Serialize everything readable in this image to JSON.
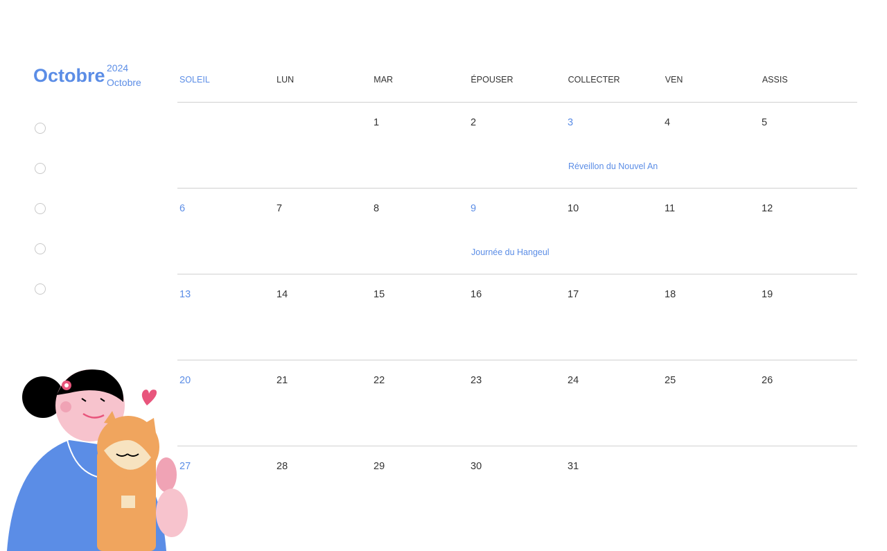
{
  "header": {
    "month": "Octobre",
    "year": "2024",
    "month_sub": "Octobre"
  },
  "checklist_count": 5,
  "weekdays": [
    "SOLEIL",
    "LUN",
    "MAR",
    "ÉPOUSER",
    "COLLECTER",
    "VEN",
    "ASSIS"
  ],
  "weeks": [
    [
      {
        "d": ""
      },
      {
        "d": ""
      },
      {
        "d": "1"
      },
      {
        "d": "2"
      },
      {
        "d": "3",
        "event": "Réveillon du Nouvel An"
      },
      {
        "d": "4"
      },
      {
        "d": "5"
      }
    ],
    [
      {
        "d": "6"
      },
      {
        "d": "7"
      },
      {
        "d": "8"
      },
      {
        "d": "9",
        "event": "Journée du Hangeul"
      },
      {
        "d": "10"
      },
      {
        "d": "11"
      },
      {
        "d": "12"
      }
    ],
    [
      {
        "d": "13"
      },
      {
        "d": "14"
      },
      {
        "d": "15"
      },
      {
        "d": "16"
      },
      {
        "d": "17"
      },
      {
        "d": "18"
      },
      {
        "d": "19"
      }
    ],
    [
      {
        "d": "20"
      },
      {
        "d": "21"
      },
      {
        "d": "22"
      },
      {
        "d": "23"
      },
      {
        "d": "24"
      },
      {
        "d": "25"
      },
      {
        "d": "26"
      }
    ],
    [
      {
        "d": "27"
      },
      {
        "d": "28"
      },
      {
        "d": "29"
      },
      {
        "d": "30"
      },
      {
        "d": "31"
      },
      {
        "d": ""
      },
      {
        "d": ""
      }
    ]
  ],
  "colors": {
    "accent": "#5b8de6",
    "grid": "#d0d0d0"
  }
}
